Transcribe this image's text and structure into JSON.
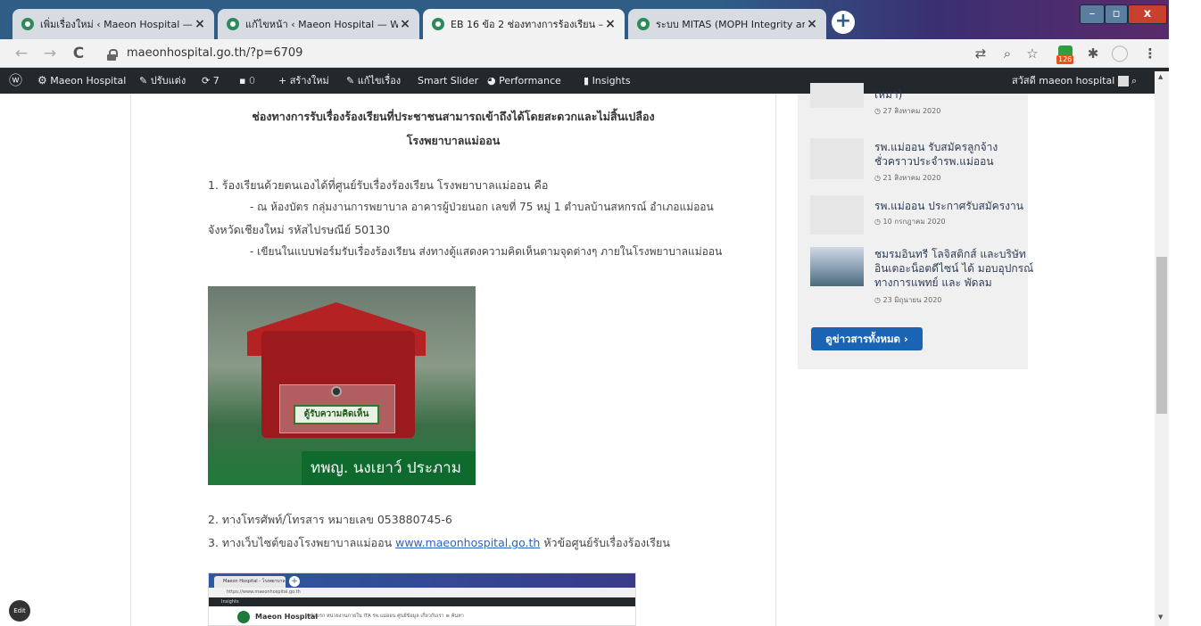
{
  "tabs": [
    {
      "title": "เพิ่มเรื่องใหม่ ‹ Maeon Hospital —",
      "close": "×"
    },
    {
      "title": "แก้ไขหน้า ‹ Maeon Hospital — W",
      "close": "×"
    },
    {
      "title": "EB 16 ข้อ 2 ช่องทางการร้องเรียน –",
      "close": "×"
    },
    {
      "title": "ระบบ MITAS (MOPH Integrity and",
      "close": "×"
    }
  ],
  "new_tab_label": "+",
  "window_controls": [
    "–",
    "▫",
    "x"
  ],
  "toolbar": {
    "url": "maeonhospital.go.th/?p=6709",
    "extension_badge": "126",
    "icons": [
      "back-icon",
      "forward-icon",
      "reload-icon",
      "translate-icon",
      "zoom-icon",
      "star-icon",
      "extensions-icon",
      "profile-icon",
      "menu-icon"
    ]
  },
  "adminbar": {
    "site_name": "Maeon Hospital",
    "customize": "ปรับแต่ง",
    "updates": "7",
    "comments": "0",
    "new": "สร้างใหม่",
    "edit_post": "แก้ไขเรื่อง",
    "smart_slider": "Smart Slider",
    "performance": "Performance",
    "insights": "Insights",
    "greeting": "สวัสดี maeon hospital"
  },
  "article": {
    "heading_line1": "ช่องทางการรับเรื่องร้องเรียนที่ประชาชนสามารถเข้าถึงได้โดยสะดวกและไม่สิ้นเปลือง",
    "heading_line2": "โรงพยาบาลแม่ออน",
    "item1": "1. ร้องเรียนด้วยตนเองได้ที่ศูนย์รับเรื่องร้องเรียน โรงพยาบาลแม่ออน คือ",
    "item1_sub1": "- ณ ห้องบัตร กลุ่มงานการพยาบาล อาคารผู้ป่วยนอก เลขที่ 75 หมู่ 1 ตำบลบ้านสหกรณ์ อำเภอแม่ออน",
    "item1_sub1_cont": "จังหวัดเชียงใหม่ รหัสไปรษณีย์ 50130",
    "item1_sub2": "- เขียนในแบบฟอร์มรับเรื่องร้องเรียน ส่งทางตู้แสดงความคิดเห็นตามจุดต่างๆ ภายในโรงพยาบาลแม่ออน",
    "photo_box_label": "ตู้รับความคิดเห็น",
    "photo_banner": "ทพญ. นงเยาว์ ประภาม",
    "item2": "2. ทางโทรศัพท์/โทรสาร หมายเลข 053880745-6",
    "item3_prefix": "3. ทางเว็บไซต์ของโรงพยาบาลแม่ออน ",
    "item3_link": "www.maeonhospital.go.th",
    "item3_suffix": " หัวข้อศูนย์รับเรื่องร้องเรียน",
    "shot_tab": "Maeon Hospital - โรงพยาบาล ×",
    "shot_url": "https://www.maeonhospital.go.th",
    "shot_adminbar": "Insights",
    "shot_brand": "Maeon Hospital",
    "shot_menu": "หน้าแรก   หน่วยงานภายใน   ITA รพ.แม่ออน   ศูนย์ข้อมูล   เกี่ยวกับเรา   ≡   ค้นหา"
  },
  "sidebar": {
    "items": [
      {
        "title_line1": "เหมา)",
        "date": "◷ 27 สิงหาคม 2020"
      },
      {
        "title_line1": "รพ.แม่ออน รับสมัครลูกจ้าง",
        "title_line2": "ชั่วคราวประจำรพ.แม่ออน",
        "date": "◷ 21 สิงหาคม 2020"
      },
      {
        "title_line1": "รพ.แม่ออน ประกาศรับสมัครงาน",
        "date": "◷ 10 กรกฎาคม 2020"
      },
      {
        "title_line1": "ชมรมอินทรี โลจิสติกส์ และบริษัท",
        "title_line2": "อินเตอะน็อตดีไซน์ ได้ มอบอุปกรณ์",
        "title_line3": "ทางการแพทย์ และ พัดลม",
        "date": "◷ 23 มิถุนายน 2020"
      }
    ],
    "read_all": "ดูข่าวสารทั้งหมด ›"
  },
  "edit_button": "Edit"
}
